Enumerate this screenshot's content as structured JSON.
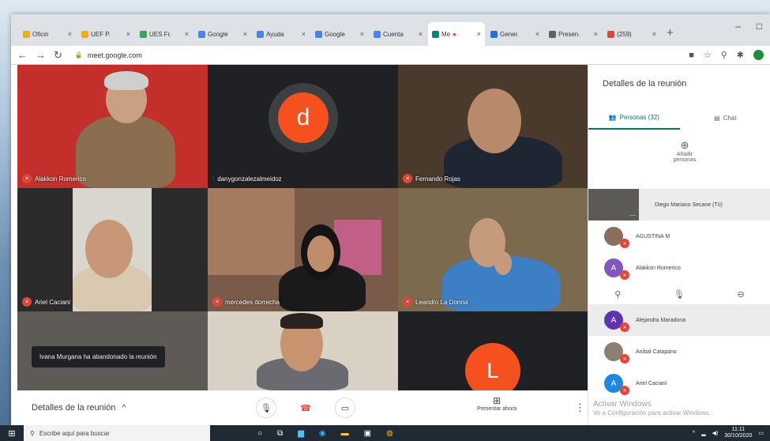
{
  "browser": {
    "tabs": [
      "Oficin",
      "UEF P.",
      "UES Fr.",
      "Google",
      "Ayuda",
      "Google",
      "Cuenta",
      "Me",
      "Gener.",
      "Presen.",
      "(259)"
    ],
    "active_tab_index": 7,
    "url": "meet.google.com"
  },
  "meeting": {
    "tiles": [
      {
        "name": "Alakkon Romerico",
        "muted": true
      },
      {
        "name": "danygonzalezalmeidoz",
        "muted": false,
        "avatar_letter": "d"
      },
      {
        "name": "Fernando Rojas",
        "muted": true
      },
      {
        "name": "Ariel Caciani",
        "muted": true
      },
      {
        "name": "mercedes dorrecha",
        "muted": true
      },
      {
        "name": "Leandro La Donna",
        "muted": true
      },
      {
        "name": "",
        "muted": false
      },
      {
        "name": "",
        "muted": false
      },
      {
        "name": "",
        "muted": false,
        "avatar_letter": "L"
      }
    ],
    "toast": "Ivana Murgana ha abandonado la reunión",
    "bottom_bar": {
      "details_label": "Detalles de la reunión",
      "present_label": "Presentar ahora"
    }
  },
  "panel": {
    "title": "Detalles de la reunión",
    "tab_people": "Personas (32)",
    "tab_chat": "Chat",
    "add_people": "Añadir personas",
    "participants": [
      {
        "name": "Diego Mariano Secane (Tú)",
        "avatar": "",
        "muted": false
      },
      {
        "name": "AGUSTINA M",
        "avatar": "",
        "muted": true
      },
      {
        "name": "Alakkon Romerico",
        "avatar": "A",
        "muted": true
      },
      {
        "name": "Alejandra Maradona",
        "avatar": "A",
        "muted": true
      },
      {
        "name": "Anibal Catapano",
        "avatar": "",
        "muted": true
      },
      {
        "name": "Ariel Caciani",
        "avatar": "A",
        "muted": true
      }
    ]
  },
  "watermark": {
    "line1": "Activar Windows",
    "line2": "Ve a Configuración para activar Windows."
  },
  "taskbar": {
    "search_placeholder": "Escribe aquí para buscar",
    "time": "11:11",
    "date": "30/10/2020"
  },
  "colors": {
    "meet_red": "#ea4335",
    "meet_teal": "#00796b",
    "tile_bg": "#202124"
  }
}
